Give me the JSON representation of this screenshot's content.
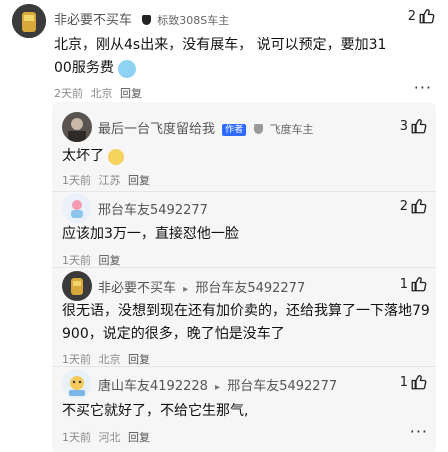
{
  "comments": [
    {
      "user": "非必要不买车",
      "badge": "标致308S车主",
      "text_line1": "北京，刚从4s出来，没有展车， 说可以预定，要加31",
      "text_line2": "00服务费",
      "time": "2天前",
      "location": "北京",
      "reply_label": "回复",
      "likes": "2"
    }
  ],
  "replies": [
    {
      "user": "最后一台飞度留给我",
      "author_tag": "作者",
      "badge": "飞度车主",
      "text": "太坏了",
      "time": "1天前",
      "location": "江苏",
      "reply_label": "回复",
      "likes": "3"
    },
    {
      "user": "邢台车友5492277",
      "text": "应该加3万一，直接怼他一脸",
      "time": "1天前",
      "location": "",
      "reply_label": "回复",
      "likes": "2"
    },
    {
      "user": "非必要不买车",
      "reply_to": "邢台车友5492277",
      "text_line1": "很无语，没想到现在还有加价卖的，还给我算了一下落地79",
      "text_line2": "900，说定的很多，晚了怕是没车了",
      "time": "1天前",
      "location": "北京",
      "reply_label": "回复",
      "likes": "1"
    },
    {
      "user": "唐山车友4192228",
      "reply_to": "邢台车友5492277",
      "text": "不买它就好了，不给它生那气,",
      "time": "1天前",
      "location": "河北",
      "reply_label": "回复",
      "likes": "1"
    }
  ],
  "icons": {
    "like": "thumbs-up-icon",
    "more": "more-dots-icon",
    "reply_arrow": "right-triangle-icon",
    "badge": "brand-shield-icon"
  },
  "colors": {
    "author_tag": "#2f6bff",
    "reply_bg": "#f6f6f7"
  }
}
